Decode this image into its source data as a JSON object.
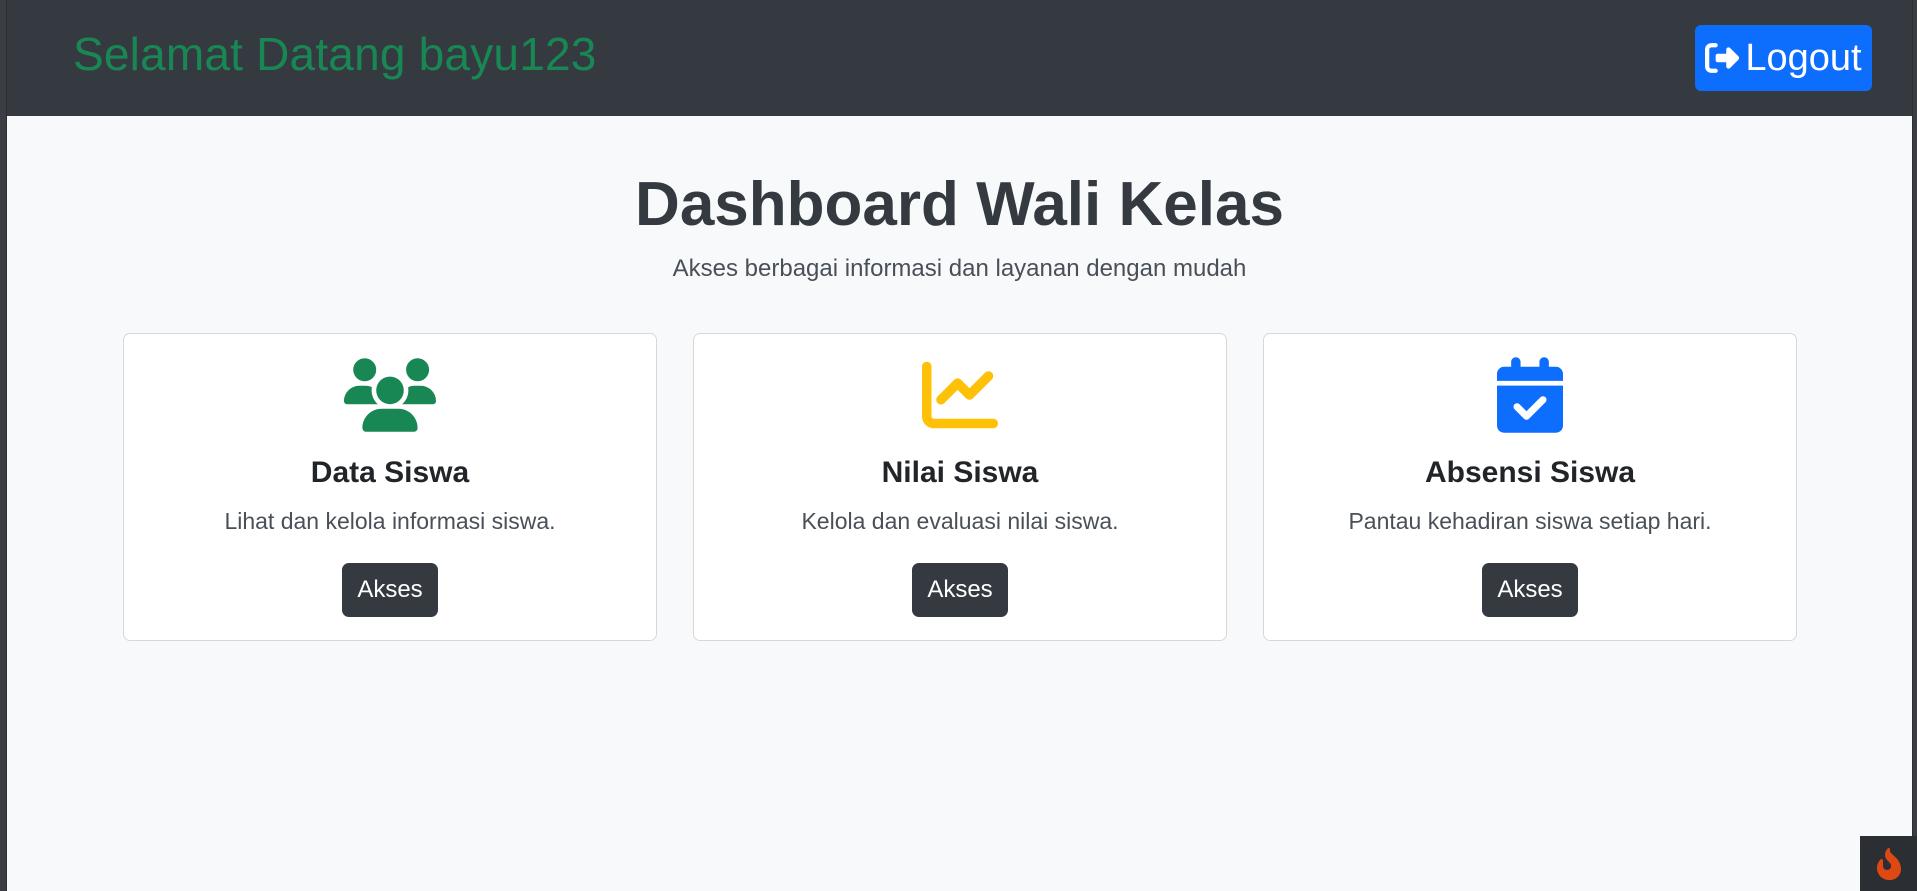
{
  "navbar": {
    "brand_text": "Selamat Datang bayu123",
    "logout_label": "Logout"
  },
  "main": {
    "title": "Dashboard Wali Kelas",
    "subtitle": "Akses berbagai informasi dan layanan dengan mudah"
  },
  "cards": [
    {
      "icon": "users-icon",
      "icon_color": "#198754",
      "title": "Data Siswa",
      "description": "Lihat dan kelola informasi siswa.",
      "button_label": "Akses"
    },
    {
      "icon": "chart-line-icon",
      "icon_color": "#ffc107",
      "title": "Nilai Siswa",
      "description": "Kelola dan evaluasi nilai siswa.",
      "button_label": "Akses"
    },
    {
      "icon": "calendar-check-icon",
      "icon_color": "#0d6efd",
      "title": "Absensi Siswa",
      "description": "Pantau kehadiran siswa setiap hari.",
      "button_label": "Akses"
    }
  ],
  "colors": {
    "navbar_bg": "#343a40",
    "brand": "#198754",
    "primary": "#0d6efd",
    "dark_button": "#343a40",
    "page_bg": "#f8f9fa"
  },
  "debug_toolbar": {
    "icon": "flame-icon"
  }
}
